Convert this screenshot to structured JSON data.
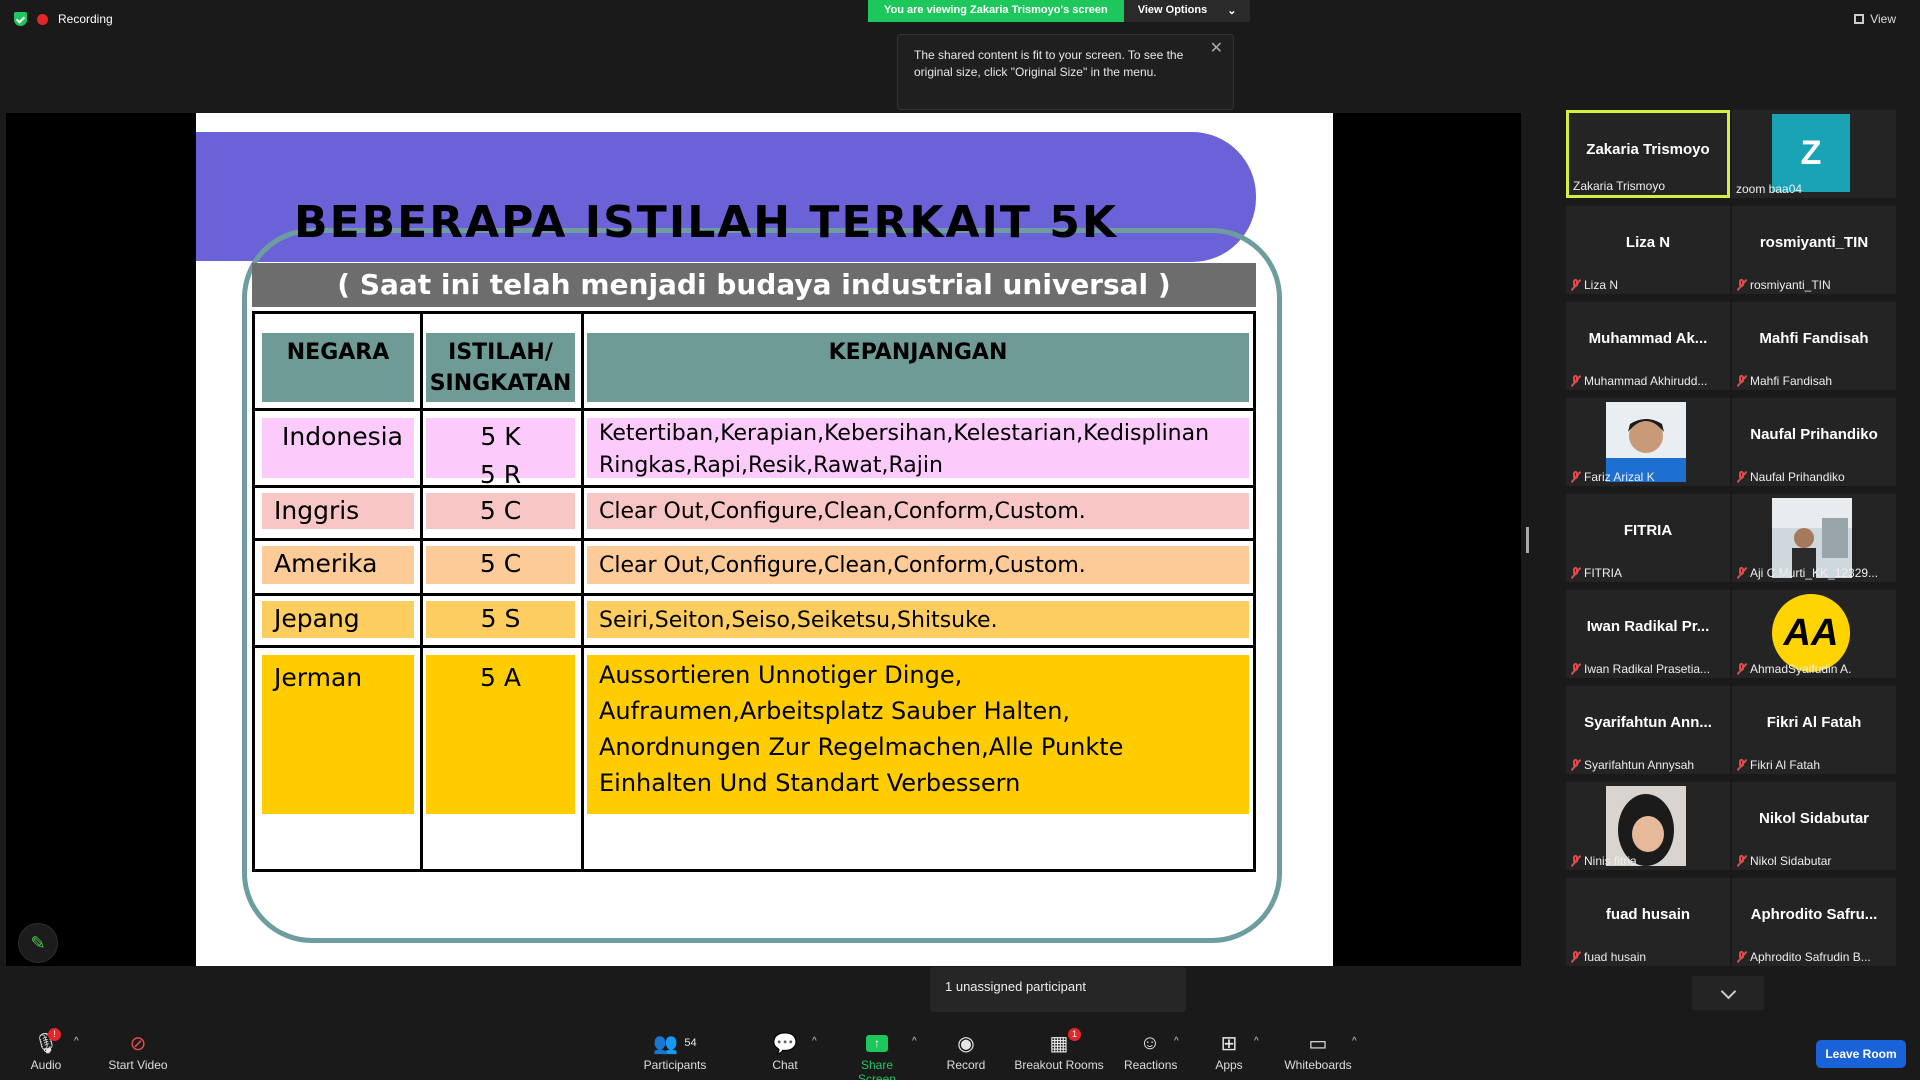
{
  "top": {
    "recording": "Recording",
    "viewing_banner": "You are viewing Zakaria Trismoyo's screen",
    "view_options": "View Options",
    "view": "View",
    "tooltip": "The shared content is fit to your screen. To see the original size, click \"Original Size\" in the menu."
  },
  "slide": {
    "title": "BEBERAPA ISTILAH TERKAIT 5K",
    "subtitle": "( Saat ini telah menjadi budaya industrial universal )",
    "headers": [
      "NEGARA",
      "ISTILAH/\nSINGKATAN",
      "KEPANJANGAN"
    ],
    "rows": [
      {
        "negara": "Indonesia",
        "istilah": [
          "5 K",
          "5 R"
        ],
        "kepanjangan": [
          "Ketertiban,Kerapian,Kebersihan,Kelestarian,Kedisplinan",
          "Ringkas,Rapi,Resik,Rawat,Rajin"
        ],
        "color": "#fccbfc"
      },
      {
        "negara": "Inggris",
        "istilah": [
          "5 C"
        ],
        "kepanjangan": [
          "Clear Out,Configure,Clean,Conform,Custom."
        ],
        "color": "#f9c6c6"
      },
      {
        "negara": "Amerika",
        "istilah": [
          "5 C"
        ],
        "kepanjangan": [
          "Clear Out,Configure,Clean,Conform,Custom."
        ],
        "color": "#fccb98"
      },
      {
        "negara": "Jepang",
        "istilah": [
          "5 S"
        ],
        "kepanjangan": [
          "Seiri,Seiton,Seiso,Seiketsu,Shitsuke."
        ],
        "color": "#fdcd60"
      },
      {
        "negara": "Jerman",
        "istilah": [
          "5 A"
        ],
        "kepanjangan": [
          "Aussortieren Unnotiger Dinge,",
          "Aufraumen,Arbeitsplatz Sauber Halten,",
          "Anordnungen Zur Regelmachen,Alle Punkte",
          "Einhalten Und Standart Verbessern"
        ],
        "color": "#ffcc00"
      }
    ]
  },
  "participants": [
    {
      "name": "Zakaria Trismoyo",
      "label": "Zakaria Trismoyo",
      "type": "active"
    },
    {
      "name": "Z",
      "label": "zoom baa04",
      "type": "avatar-z"
    },
    {
      "name": "Liza N",
      "label": "Liza N",
      "type": "muted"
    },
    {
      "name": "rosmiyanti_TIN",
      "label": "rosmiyanti_TIN",
      "type": "muted"
    },
    {
      "name": "Muhammad  Ak...",
      "label": "Muhammad Akhirudd...",
      "type": "muted"
    },
    {
      "name": "Mahfi Fandisah",
      "label": "Mahfi Fandisah",
      "type": "muted"
    },
    {
      "name": "",
      "label": "Fariz Arizal K",
      "type": "photo-man"
    },
    {
      "name": "Naufal Prihandiko",
      "label": "Naufal Prihandiko",
      "type": "muted"
    },
    {
      "name": "FITRIA",
      "label": "FITRIA",
      "type": "muted"
    },
    {
      "name": "",
      "label": "Aji C.Murti_KK_12329...",
      "type": "photo-room"
    },
    {
      "name": "Iwan  Radikal  Pr...",
      "label": "Iwan Radikal Prasetia...",
      "type": "muted"
    },
    {
      "name": "AA",
      "label": "AhmadSyaifudin A.",
      "type": "avatar-aa"
    },
    {
      "name": "Syarifahtun  Ann...",
      "label": "Syarifahtun Annysah",
      "type": "muted"
    },
    {
      "name": "Fikri Al Fatah",
      "label": "Fikri Al Fatah",
      "type": "muted"
    },
    {
      "name": "",
      "label": "Ninis fitria",
      "type": "photo-woman"
    },
    {
      "name": "Nikol Sidabutar",
      "label": "Nikol Sidabutar",
      "type": "muted"
    },
    {
      "name": "fuad husain",
      "label": "fuad husain",
      "type": "muted"
    },
    {
      "name": "Aphrodito  Safru...",
      "label": "Aphrodito Safrudin B...",
      "type": "muted"
    }
  ],
  "unassigned": "1 unassigned participant",
  "toolbar": {
    "audio": "Audio",
    "audio_badge": "!",
    "start_video": "Start Video",
    "participants": "Participants",
    "participants_count": "54",
    "chat": "Chat",
    "share_screen": "Share Screen",
    "record": "Record",
    "breakout_rooms": "Breakout Rooms",
    "breakout_badge": "1",
    "reactions": "Reactions",
    "apps": "Apps",
    "whiteboards": "Whiteboards",
    "leave_room": "Leave Room"
  },
  "colors": {
    "accent_green": "#1ec75c",
    "leave_blue": "#1a62d8",
    "active_border": "#d5ee3f",
    "banner_purple": "#6a62d6",
    "header_teal": "#6e9b96"
  }
}
